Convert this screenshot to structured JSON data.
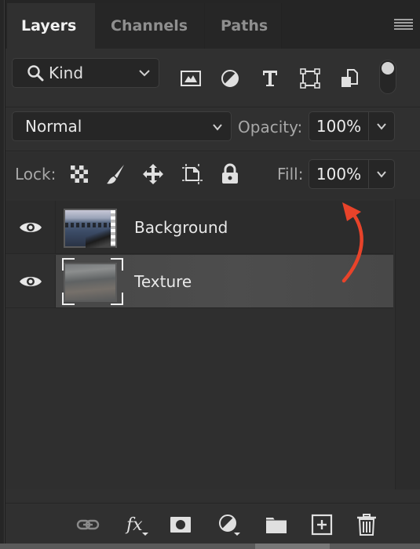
{
  "tabs": [
    {
      "label": "Layers",
      "active": true
    },
    {
      "label": "Channels",
      "active": false
    },
    {
      "label": "Paths",
      "active": false
    }
  ],
  "filter": {
    "kind_label": "Kind",
    "icons": [
      "image-filter-icon",
      "adjustment-filter-icon",
      "type-filter-icon",
      "shape-filter-icon",
      "smart-object-filter-icon"
    ],
    "filter_toggle_on": true
  },
  "blend": {
    "mode": "Normal",
    "opacity_label": "Opacity:",
    "opacity_value": "100%"
  },
  "lock": {
    "label": "Lock:",
    "icons": [
      "lock-transparent-pixels-icon",
      "lock-image-pixels-icon",
      "lock-position-icon",
      "lock-artboard-icon",
      "lock-all-icon"
    ],
    "fill_label": "Fill:",
    "fill_value": "100%"
  },
  "layers": [
    {
      "name": "Background",
      "visible": true,
      "selected": false
    },
    {
      "name": "Texture",
      "visible": true,
      "selected": true
    }
  ],
  "annotation": {
    "arrow_color": "#e8432a"
  },
  "footer": {
    "icons": [
      "link-layers-icon",
      "layer-style-fx-icon",
      "add-mask-icon",
      "new-adjustment-layer-icon",
      "new-group-icon",
      "new-layer-icon",
      "delete-layer-icon"
    ]
  }
}
